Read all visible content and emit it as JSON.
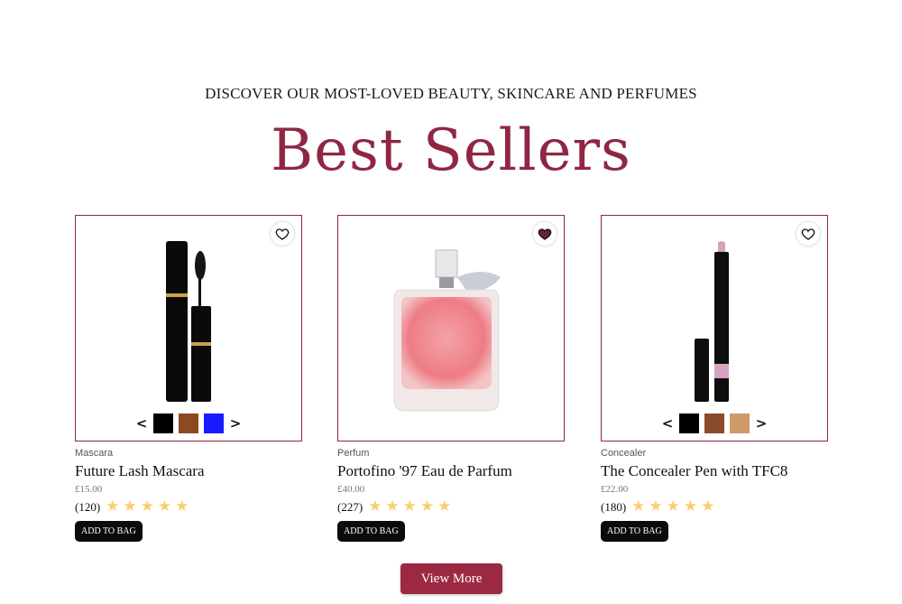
{
  "header": {
    "subtitle": "DISCOVER OUR MOST-LOVED BEAUTY, SKINCARE AND PERFUMES",
    "title": "Best Sellers"
  },
  "colors": {
    "accent": "#8f2743",
    "star": "#f8cf6f",
    "button": "#0b0b0b",
    "view_more": "#9b2942"
  },
  "products": [
    {
      "category": "Mascara",
      "name": "Future Lash Mascara",
      "price": "£15.00",
      "reviews": "(120)",
      "rating": 5,
      "add_label": "ADD TO BAG",
      "wishlisted": false,
      "swatches": [
        "#000000",
        "#8b4a1f",
        "#1a1aff"
      ],
      "prev_icon": "<",
      "next_icon": ">"
    },
    {
      "category": "Perfum",
      "name": "Portofino '97 Eau de Parfum",
      "price": "£40.00",
      "reviews": "(227)",
      "rating": 5,
      "add_label": "ADD TO BAG",
      "wishlisted": true,
      "swatches": []
    },
    {
      "category": "Concealer",
      "name": "The Concealer Pen with TFC8",
      "price": "£22.00",
      "reviews": "(180)",
      "rating": 5,
      "add_label": "ADD TO BAG",
      "wishlisted": false,
      "swatches": [
        "#000000",
        "#8b4a2a",
        "#cf9a6a"
      ],
      "prev_icon": "<",
      "next_icon": ">"
    }
  ],
  "view_more_label": "View More"
}
